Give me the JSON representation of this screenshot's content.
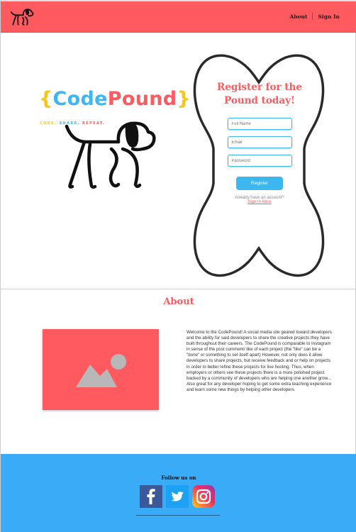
{
  "header": {
    "nav": {
      "about": "About",
      "signin": "Sign In"
    },
    "bg_color": "#ff5a5f",
    "logo_icon": "dog-icon"
  },
  "hero": {
    "brand": {
      "open_brace": "{",
      "code": "Code",
      "pound": "Pound",
      "close_brace": "}"
    },
    "tagline": {
      "part1": "CODE.",
      "part2": "SHARE.",
      "part3": "REPEAT."
    },
    "register": {
      "title": "Register for the Pound today!",
      "fullname_placeholder": "Full Name",
      "email_placeholder": "Email",
      "password_placeholder": "Password",
      "button": "Register",
      "already": "Already have an account?",
      "signin_link": "Sign In Here"
    }
  },
  "about": {
    "title": "About",
    "image_icon": "image-placeholder-icon",
    "text": "Welcome to the CodePound! A social media site geared toward developers and the ability for said developers to share the creative projects they have built throughout their careers. The CodePound is comparable to Instagram in sense of the post comment/ like of each project (the \"like\" can be a \"bone\" or something to set itself apart) However, not only does it allow developers to share projects, but receive feedback and or help on projects in order to better refine these projects for live hosting. Thus, when employers or others see these projects there is a more polished project backed by a community of developers who are helping one another grow... Also great for any developer hoping to get some extra teaching experience and learn some new things by helping other developers."
  },
  "footer": {
    "follow": "Follow us on",
    "socials": [
      "facebook-icon",
      "twitter-icon",
      "instagram-icon"
    ],
    "bg_color": "#3aabf7"
  },
  "colors": {
    "accent_red": "#ff5a5f",
    "accent_blue": "#3db7f0",
    "accent_yellow": "#f7c520"
  }
}
